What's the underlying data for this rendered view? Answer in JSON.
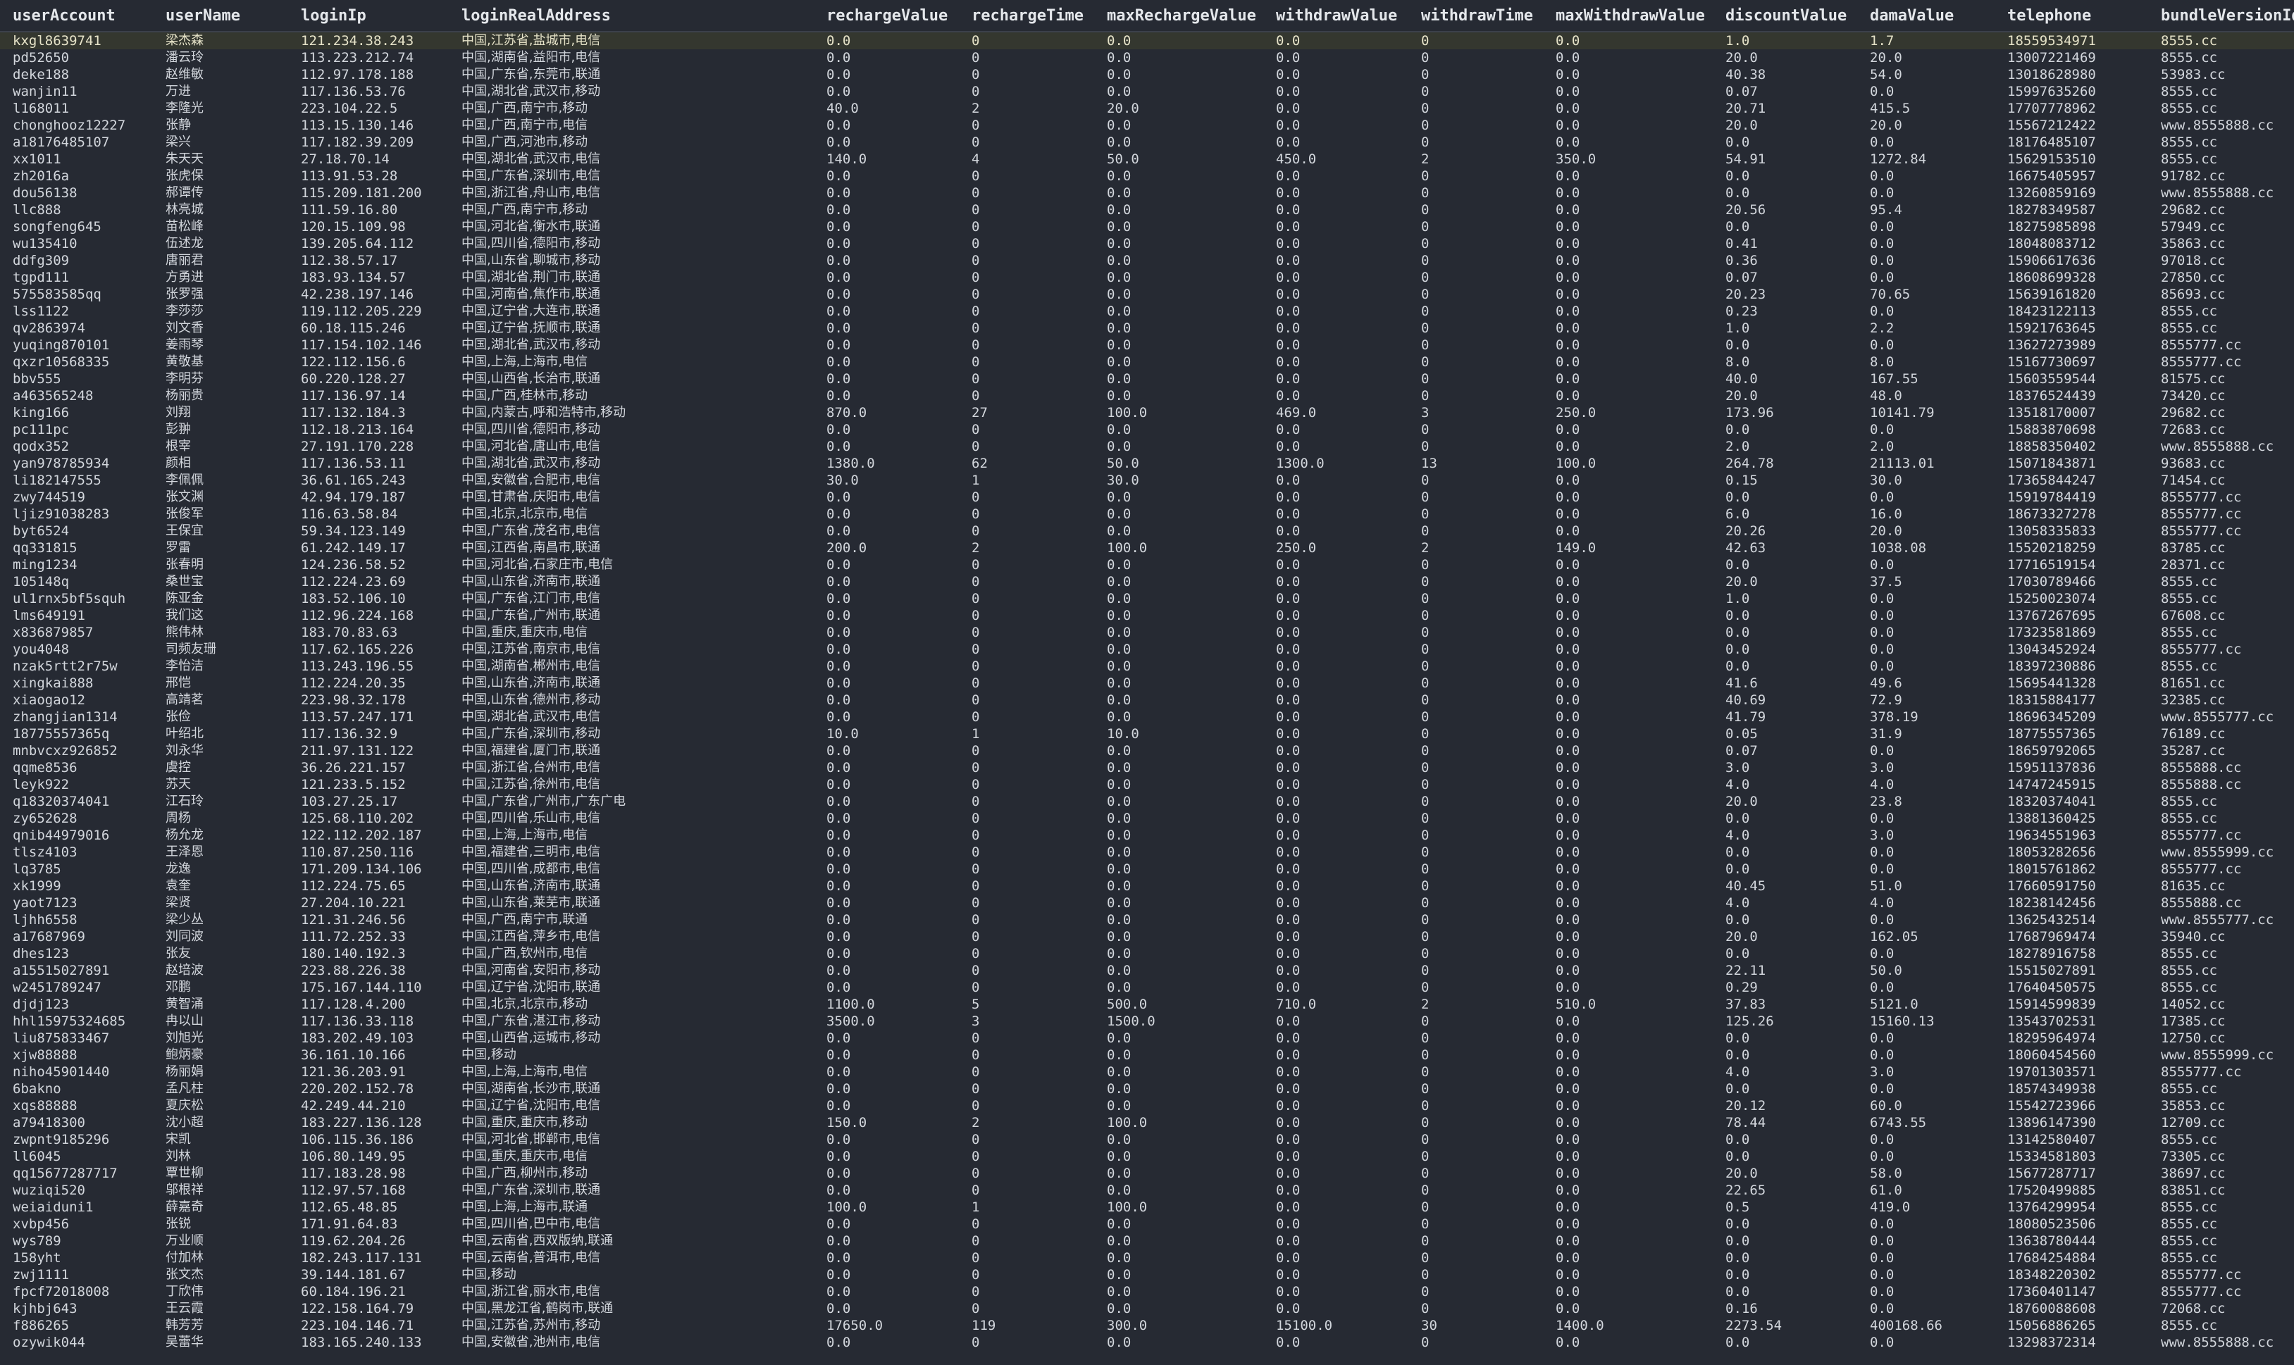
{
  "columns": [
    "userAccount",
    "userName",
    "loginIp",
    "loginRealAddress",
    "rechargeValue",
    "rechargeTime",
    "maxRechargeValue",
    "withdrawValue",
    "withdrawTime",
    "maxWithdrawValue",
    "discountValue",
    "damaValue",
    "telephone",
    "bundleVersionId"
  ],
  "selected_row": 0,
  "rows": [
    [
      "kxgl8639741",
      "梁杰森",
      "121.234.38.243",
      "中国,江苏省,盐城市,电信",
      "0.0",
      "0",
      "0.0",
      "0.0",
      "0",
      "0.0",
      "1.0",
      "1.7",
      "18559534971",
      "8555.cc"
    ],
    [
      "pd52650",
      "潘云玲",
      "113.223.212.74",
      "中国,湖南省,益阳市,电信",
      "0.0",
      "0",
      "0.0",
      "0.0",
      "0",
      "0.0",
      "20.0",
      "20.0",
      "13007221469",
      "8555.cc"
    ],
    [
      "deke188",
      "赵维敏",
      "112.97.178.188",
      "中国,广东省,东莞市,联通",
      "0.0",
      "0",
      "0.0",
      "0.0",
      "0",
      "0.0",
      "40.38",
      "54.0",
      "13018628980",
      "53983.cc"
    ],
    [
      "wanjin11",
      "万进",
      "117.136.53.76",
      "中国,湖北省,武汉市,移动",
      "0.0",
      "0",
      "0.0",
      "0.0",
      "0",
      "0.0",
      "0.07",
      "0.0",
      "15997635260",
      "8555.cc"
    ],
    [
      "l168011",
      "李隆光",
      "223.104.22.5",
      "中国,广西,南宁市,移动",
      "40.0",
      "2",
      "20.0",
      "0.0",
      "0",
      "0.0",
      "20.71",
      "415.5",
      "17707778962",
      "8555.cc"
    ],
    [
      "chonghooz12227",
      "张静",
      "113.15.130.146",
      "中国,广西,南宁市,电信",
      "0.0",
      "0",
      "0.0",
      "0.0",
      "0",
      "0.0",
      "20.0",
      "20.0",
      "15567212422",
      "www.8555888.cc"
    ],
    [
      "a18176485107",
      "梁兴",
      "117.182.39.209",
      "中国,广西,河池市,移动",
      "0.0",
      "0",
      "0.0",
      "0.0",
      "0",
      "0.0",
      "0.0",
      "0.0",
      "18176485107",
      "8555.cc"
    ],
    [
      "xx1011",
      "朱天天",
      "27.18.70.14",
      "中国,湖北省,武汉市,电信",
      "140.0",
      "4",
      "50.0",
      "450.0",
      "2",
      "350.0",
      "54.91",
      "1272.84",
      "15629153510",
      "8555.cc"
    ],
    [
      "zh2016a",
      "张虎保",
      "113.91.53.28",
      "中国,广东省,深圳市,电信",
      "0.0",
      "0",
      "0.0",
      "0.0",
      "0",
      "0.0",
      "0.0",
      "0.0",
      "16675405957",
      "91782.cc"
    ],
    [
      "dou56138",
      "郝谭传",
      "115.209.181.200",
      "中国,浙江省,舟山市,电信",
      "0.0",
      "0",
      "0.0",
      "0.0",
      "0",
      "0.0",
      "0.0",
      "0.0",
      "13260859169",
      "www.8555888.cc"
    ],
    [
      "llc888",
      "林亮城",
      "111.59.16.80",
      "中国,广西,南宁市,移动",
      "0.0",
      "0",
      "0.0",
      "0.0",
      "0",
      "0.0",
      "20.56",
      "95.4",
      "18278349587",
      "29682.cc"
    ],
    [
      "songfeng645",
      "苗松峰",
      "120.15.109.98",
      "中国,河北省,衡水市,联通",
      "0.0",
      "0",
      "0.0",
      "0.0",
      "0",
      "0.0",
      "0.0",
      "0.0",
      "18275985898",
      "57949.cc"
    ],
    [
      "wu135410",
      "伍述龙",
      "139.205.64.112",
      "中国,四川省,德阳市,移动",
      "0.0",
      "0",
      "0.0",
      "0.0",
      "0",
      "0.0",
      "0.41",
      "0.0",
      "18048083712",
      "35863.cc"
    ],
    [
      "ddfg309",
      "唐丽君",
      "112.38.57.17",
      "中国,山东省,聊城市,移动",
      "0.0",
      "0",
      "0.0",
      "0.0",
      "0",
      "0.0",
      "0.36",
      "0.0",
      "15906617636",
      "97018.cc"
    ],
    [
      "tgpd111",
      "方勇进",
      "183.93.134.57",
      "中国,湖北省,荆门市,联通",
      "0.0",
      "0",
      "0.0",
      "0.0",
      "0",
      "0.0",
      "0.07",
      "0.0",
      "18608699328",
      "27850.cc"
    ],
    [
      "575583585qq",
      "张罗强",
      "42.238.197.146",
      "中国,河南省,焦作市,联通",
      "0.0",
      "0",
      "0.0",
      "0.0",
      "0",
      "0.0",
      "20.23",
      "70.65",
      "15639161820",
      "85693.cc"
    ],
    [
      "lss1122",
      "李莎莎",
      "119.112.205.229",
      "中国,辽宁省,大连市,联通",
      "0.0",
      "0",
      "0.0",
      "0.0",
      "0",
      "0.0",
      "0.23",
      "0.0",
      "18423122113",
      "8555.cc"
    ],
    [
      "qv2863974",
      "刘文香",
      "60.18.115.246",
      "中国,辽宁省,抚顺市,联通",
      "0.0",
      "0",
      "0.0",
      "0.0",
      "0",
      "0.0",
      "1.0",
      "2.2",
      "15921763645",
      "8555.cc"
    ],
    [
      "yuqing870101",
      "姜雨琴",
      "117.154.102.146",
      "中国,湖北省,武汉市,移动",
      "0.0",
      "0",
      "0.0",
      "0.0",
      "0",
      "0.0",
      "0.0",
      "0.0",
      "13627273989",
      "8555777.cc"
    ],
    [
      "qxzr10568335",
      "黄敬基",
      "122.112.156.6",
      "中国,上海,上海市,电信",
      "0.0",
      "0",
      "0.0",
      "0.0",
      "0",
      "0.0",
      "8.0",
      "8.0",
      "15167730697",
      "8555777.cc"
    ],
    [
      "bbv555",
      "李明芬",
      "60.220.128.27",
      "中国,山西省,长治市,联通",
      "0.0",
      "0",
      "0.0",
      "0.0",
      "0",
      "0.0",
      "40.0",
      "167.55",
      "15603559544",
      "81575.cc"
    ],
    [
      "a463565248",
      "杨丽贵",
      "117.136.97.14",
      "中国,广西,桂林市,移动",
      "0.0",
      "0",
      "0.0",
      "0.0",
      "0",
      "0.0",
      "20.0",
      "48.0",
      "18376524439",
      "73420.cc"
    ],
    [
      "king166",
      "刘翔",
      "117.132.184.3",
      "中国,内蒙古,呼和浩特市,移动",
      "870.0",
      "27",
      "100.0",
      "469.0",
      "3",
      "250.0",
      "173.96",
      "10141.79",
      "13518170007",
      "29682.cc"
    ],
    [
      "pc111pc",
      "彭翀",
      "112.18.213.164",
      "中国,四川省,德阳市,移动",
      "0.0",
      "0",
      "0.0",
      "0.0",
      "0",
      "0.0",
      "0.0",
      "0.0",
      "15883870698",
      "72683.cc"
    ],
    [
      "qodx352",
      "根宰",
      "27.191.170.228",
      "中国,河北省,唐山市,电信",
      "0.0",
      "0",
      "0.0",
      "0.0",
      "0",
      "0.0",
      "2.0",
      "2.0",
      "18858350402",
      "www.8555888.cc"
    ],
    [
      "yan978785934",
      "颜相",
      "117.136.53.11",
      "中国,湖北省,武汉市,移动",
      "1380.0",
      "62",
      "50.0",
      "1300.0",
      "13",
      "100.0",
      "264.78",
      "21113.01",
      "15071843871",
      "93683.cc"
    ],
    [
      "li182147555",
      "李佩佩",
      "36.61.165.243",
      "中国,安徽省,合肥市,电信",
      "30.0",
      "1",
      "30.0",
      "0.0",
      "0",
      "0.0",
      "0.15",
      "30.0",
      "17365844247",
      "71454.cc"
    ],
    [
      "zwy744519",
      "张文渊",
      "42.94.179.187",
      "中国,甘肃省,庆阳市,电信",
      "0.0",
      "0",
      "0.0",
      "0.0",
      "0",
      "0.0",
      "0.0",
      "0.0",
      "15919784419",
      "8555777.cc"
    ],
    [
      "ljiz91038283",
      "张俊军",
      "116.63.58.84",
      "中国,北京,北京市,电信",
      "0.0",
      "0",
      "0.0",
      "0.0",
      "0",
      "0.0",
      "6.0",
      "16.0",
      "18673327278",
      "8555777.cc"
    ],
    [
      "byt6524",
      "王保宜",
      "59.34.123.149",
      "中国,广东省,茂名市,电信",
      "0.0",
      "0",
      "0.0",
      "0.0",
      "0",
      "0.0",
      "20.26",
      "20.0",
      "13058335833",
      "8555777.cc"
    ],
    [
      "qq331815",
      "罗雷",
      "61.242.149.17",
      "中国,江西省,南昌市,联通",
      "200.0",
      "2",
      "100.0",
      "250.0",
      "2",
      "149.0",
      "42.63",
      "1038.08",
      "15520218259",
      "83785.cc"
    ],
    [
      "ming1234",
      "张春明",
      "124.236.58.52",
      "中国,河北省,石家庄市,电信",
      "0.0",
      "0",
      "0.0",
      "0.0",
      "0",
      "0.0",
      "0.0",
      "0.0",
      "17716519154",
      "28371.cc"
    ],
    [
      "105148q",
      "桑世宝",
      "112.224.23.69",
      "中国,山东省,济南市,联通",
      "0.0",
      "0",
      "0.0",
      "0.0",
      "0",
      "0.0",
      "20.0",
      "37.5",
      "17030789466",
      "8555.cc"
    ],
    [
      "ul1rnx5bf5squh",
      "陈亚金",
      "183.52.106.10",
      "中国,广东省,江门市,电信",
      "0.0",
      "0",
      "0.0",
      "0.0",
      "0",
      "0.0",
      "1.0",
      "0.0",
      "15250023074",
      "8555.cc"
    ],
    [
      "lms649191",
      "我们这",
      "112.96.224.168",
      "中国,广东省,广州市,联通",
      "0.0",
      "0",
      "0.0",
      "0.0",
      "0",
      "0.0",
      "0.0",
      "0.0",
      "13767267695",
      "67608.cc"
    ],
    [
      "x836879857",
      "熊伟林",
      "183.70.83.63",
      "中国,重庆,重庆市,电信",
      "0.0",
      "0",
      "0.0",
      "0.0",
      "0",
      "0.0",
      "0.0",
      "0.0",
      "17323581869",
      "8555.cc"
    ],
    [
      "you4048",
      "司频友珊",
      "117.62.165.226",
      "中国,江苏省,南京市,电信",
      "0.0",
      "0",
      "0.0",
      "0.0",
      "0",
      "0.0",
      "0.0",
      "0.0",
      "13043452924",
      "8555777.cc"
    ],
    [
      "nzak5rtt2r75w",
      "李怡洁",
      "113.243.196.55",
      "中国,湖南省,郴州市,电信",
      "0.0",
      "0",
      "0.0",
      "0.0",
      "0",
      "0.0",
      "0.0",
      "0.0",
      "18397230886",
      "8555.cc"
    ],
    [
      "xingkai888",
      "邢恺",
      "112.224.20.35",
      "中国,山东省,济南市,联通",
      "0.0",
      "0",
      "0.0",
      "0.0",
      "0",
      "0.0",
      "41.6",
      "49.6",
      "15695441328",
      "81651.cc"
    ],
    [
      "xiaogao12",
      "高靖茗",
      "223.98.32.178",
      "中国,山东省,德州市,移动",
      "0.0",
      "0",
      "0.0",
      "0.0",
      "0",
      "0.0",
      "40.69",
      "72.9",
      "18315884177",
      "32385.cc"
    ],
    [
      "zhangjian1314",
      "张俭",
      "113.57.247.171",
      "中国,湖北省,武汉市,电信",
      "0.0",
      "0",
      "0.0",
      "0.0",
      "0",
      "0.0",
      "41.79",
      "378.19",
      "18696345209",
      "www.8555777.cc"
    ],
    [
      "18775557365q",
      "叶绍北",
      "117.136.32.9",
      "中国,广东省,深圳市,移动",
      "10.0",
      "1",
      "10.0",
      "0.0",
      "0",
      "0.0",
      "0.05",
      "31.9",
      "18775557365",
      "76189.cc"
    ],
    [
      "mnbvcxz926852",
      "刘永华",
      "211.97.131.122",
      "中国,福建省,厦门市,联通",
      "0.0",
      "0",
      "0.0",
      "0.0",
      "0",
      "0.0",
      "0.07",
      "0.0",
      "18659792065",
      "35287.cc"
    ],
    [
      "qqme8536",
      "虞控",
      "36.26.221.157",
      "中国,浙江省,台州市,电信",
      "0.0",
      "0",
      "0.0",
      "0.0",
      "0",
      "0.0",
      "3.0",
      "3.0",
      "15951137836",
      "8555888.cc"
    ],
    [
      "leyk922",
      "苏天",
      "121.233.5.152",
      "中国,江苏省,徐州市,电信",
      "0.0",
      "0",
      "0.0",
      "0.0",
      "0",
      "0.0",
      "4.0",
      "4.0",
      "14747245915",
      "8555888.cc"
    ],
    [
      "q18320374041",
      "江石玲",
      "103.27.25.17",
      "中国,广东省,广州市,广东广电",
      "0.0",
      "0",
      "0.0",
      "0.0",
      "0",
      "0.0",
      "20.0",
      "23.8",
      "18320374041",
      "8555.cc"
    ],
    [
      "zy652628",
      "周杨",
      "125.68.110.202",
      "中国,四川省,乐山市,电信",
      "0.0",
      "0",
      "0.0",
      "0.0",
      "0",
      "0.0",
      "0.0",
      "0.0",
      "13881360425",
      "8555.cc"
    ],
    [
      "qnib44979016",
      "杨允龙",
      "122.112.202.187",
      "中国,上海,上海市,电信",
      "0.0",
      "0",
      "0.0",
      "0.0",
      "0",
      "0.0",
      "4.0",
      "3.0",
      "19634551963",
      "8555777.cc"
    ],
    [
      "tlsz4103",
      "王泽恩",
      "110.87.250.116",
      "中国,福建省,三明市,电信",
      "0.0",
      "0",
      "0.0",
      "0.0",
      "0",
      "0.0",
      "0.0",
      "0.0",
      "18053282656",
      "www.8555999.cc"
    ],
    [
      "lq3785",
      "龙逸",
      "171.209.134.106",
      "中国,四川省,成都市,电信",
      "0.0",
      "0",
      "0.0",
      "0.0",
      "0",
      "0.0",
      "0.0",
      "0.0",
      "18015761862",
      "8555777.cc"
    ],
    [
      "xk1999",
      "袁奎",
      "112.224.75.65",
      "中国,山东省,济南市,联通",
      "0.0",
      "0",
      "0.0",
      "0.0",
      "0",
      "0.0",
      "40.45",
      "51.0",
      "17660591750",
      "81635.cc"
    ],
    [
      "yaot7123",
      "梁贤",
      "27.204.10.221",
      "中国,山东省,莱芜市,联通",
      "0.0",
      "0",
      "0.0",
      "0.0",
      "0",
      "0.0",
      "4.0",
      "4.0",
      "18238142456",
      "8555888.cc"
    ],
    [
      "ljhh6558",
      "梁少丛",
      "121.31.246.56",
      "中国,广西,南宁市,联通",
      "0.0",
      "0",
      "0.0",
      "0.0",
      "0",
      "0.0",
      "0.0",
      "0.0",
      "13625432514",
      "www.8555777.cc"
    ],
    [
      "a17687969",
      "刘同波",
      "111.72.252.33",
      "中国,江西省,萍乡市,电信",
      "0.0",
      "0",
      "0.0",
      "0.0",
      "0",
      "0.0",
      "20.0",
      "162.05",
      "17687969474",
      "35940.cc"
    ],
    [
      "dhes123",
      "张友",
      "180.140.192.3",
      "中国,广西,钦州市,电信",
      "0.0",
      "0",
      "0.0",
      "0.0",
      "0",
      "0.0",
      "0.0",
      "0.0",
      "18278916758",
      "8555.cc"
    ],
    [
      "a15515027891",
      "赵培波",
      "223.88.226.38",
      "中国,河南省,安阳市,移动",
      "0.0",
      "0",
      "0.0",
      "0.0",
      "0",
      "0.0",
      "22.11",
      "50.0",
      "15515027891",
      "8555.cc"
    ],
    [
      "w2451789247",
      "邓鹏",
      "175.167.144.110",
      "中国,辽宁省,沈阳市,联通",
      "0.0",
      "0",
      "0.0",
      "0.0",
      "0",
      "0.0",
      "0.29",
      "0.0",
      "17640450575",
      "8555.cc"
    ],
    [
      "djdj123",
      "黄智涌",
      "117.128.4.200",
      "中国,北京,北京市,移动",
      "1100.0",
      "5",
      "500.0",
      "710.0",
      "2",
      "510.0",
      "37.83",
      "5121.0",
      "15914599839",
      "14052.cc"
    ],
    [
      "hhl15975324685",
      "冉以山",
      "117.136.33.118",
      "中国,广东省,湛江市,移动",
      "3500.0",
      "3",
      "1500.0",
      "0.0",
      "0",
      "0.0",
      "125.26",
      "15160.13",
      "13543702531",
      "17385.cc"
    ],
    [
      "liu875833467",
      "刘旭光",
      "183.202.49.103",
      "中国,山西省,运城市,移动",
      "0.0",
      "0",
      "0.0",
      "0.0",
      "0",
      "0.0",
      "0.0",
      "0.0",
      "18295964974",
      "12750.cc"
    ],
    [
      "xjw88888",
      "鲍炳豪",
      "36.161.10.166",
      "中国,移动",
      "0.0",
      "0",
      "0.0",
      "0.0",
      "0",
      "0.0",
      "0.0",
      "0.0",
      "18060454560",
      "www.8555999.cc"
    ],
    [
      "niho45901440",
      "杨丽娟",
      "121.36.203.91",
      "中国,上海,上海市,电信",
      "0.0",
      "0",
      "0.0",
      "0.0",
      "0",
      "0.0",
      "4.0",
      "3.0",
      "19701303571",
      "8555777.cc"
    ],
    [
      "6bakno",
      "孟凡柱",
      "220.202.152.78",
      "中国,湖南省,长沙市,联通",
      "0.0",
      "0",
      "0.0",
      "0.0",
      "0",
      "0.0",
      "0.0",
      "0.0",
      "18574349938",
      "8555.cc"
    ],
    [
      "xqs88888",
      "夏庆松",
      "42.249.44.210",
      "中国,辽宁省,沈阳市,电信",
      "0.0",
      "0",
      "0.0",
      "0.0",
      "0",
      "0.0",
      "20.12",
      "60.0",
      "15542723966",
      "35853.cc"
    ],
    [
      "a79418300",
      "沈小超",
      "183.227.136.128",
      "中国,重庆,重庆市,移动",
      "150.0",
      "2",
      "100.0",
      "0.0",
      "0",
      "0.0",
      "78.44",
      "6743.55",
      "13896147390",
      "12709.cc"
    ],
    [
      "zwpnt9185296",
      "宋凯",
      "106.115.36.186",
      "中国,河北省,邯郸市,电信",
      "0.0",
      "0",
      "0.0",
      "0.0",
      "0",
      "0.0",
      "0.0",
      "0.0",
      "13142580407",
      "8555.cc"
    ],
    [
      "ll6045",
      "刘林",
      "106.80.149.95",
      "中国,重庆,重庆市,电信",
      "0.0",
      "0",
      "0.0",
      "0.0",
      "0",
      "0.0",
      "0.0",
      "0.0",
      "15334581803",
      "73305.cc"
    ],
    [
      "qq15677287717",
      "覃世柳",
      "117.183.28.98",
      "中国,广西,柳州市,移动",
      "0.0",
      "0",
      "0.0",
      "0.0",
      "0",
      "0.0",
      "20.0",
      "58.0",
      "15677287717",
      "38697.cc"
    ],
    [
      "wuziqi520",
      "邬根祥",
      "112.97.57.168",
      "中国,广东省,深圳市,联通",
      "0.0",
      "0",
      "0.0",
      "0.0",
      "0",
      "0.0",
      "22.65",
      "61.0",
      "17520499885",
      "83851.cc"
    ],
    [
      "weiaiduni1",
      "薛嘉奇",
      "112.65.48.85",
      "中国,上海,上海市,联通",
      "100.0",
      "1",
      "100.0",
      "0.0",
      "0",
      "0.0",
      "0.5",
      "419.0",
      "13764299954",
      "8555.cc"
    ],
    [
      "xvbp456",
      "张锐",
      "171.91.64.83",
      "中国,四川省,巴中市,电信",
      "0.0",
      "0",
      "0.0",
      "0.0",
      "0",
      "0.0",
      "0.0",
      "0.0",
      "18080523506",
      "8555.cc"
    ],
    [
      "wys789",
      "万业顺",
      "119.62.204.26",
      "中国,云南省,西双版纳,联通",
      "0.0",
      "0",
      "0.0",
      "0.0",
      "0",
      "0.0",
      "0.0",
      "0.0",
      "13638780444",
      "8555.cc"
    ],
    [
      "158yht",
      "付加林",
      "182.243.117.131",
      "中国,云南省,普洱市,电信",
      "0.0",
      "0",
      "0.0",
      "0.0",
      "0",
      "0.0",
      "0.0",
      "0.0",
      "17684254884",
      "8555.cc"
    ],
    [
      "zwj1111",
      "张文杰",
      "39.144.181.67",
      "中国,移动",
      "0.0",
      "0",
      "0.0",
      "0.0",
      "0",
      "0.0",
      "0.0",
      "0.0",
      "18348220302",
      "8555777.cc"
    ],
    [
      "fpcf72018008",
      "丁欣伟",
      "60.184.196.21",
      "中国,浙江省,丽水市,电信",
      "0.0",
      "0",
      "0.0",
      "0.0",
      "0",
      "0.0",
      "0.0",
      "0.0",
      "17360401147",
      "8555777.cc"
    ],
    [
      "kjhbj643",
      "王云霞",
      "122.158.164.79",
      "中国,黑龙江省,鹤岗市,联通",
      "0.0",
      "0",
      "0.0",
      "0.0",
      "0",
      "0.0",
      "0.16",
      "0.0",
      "18760088608",
      "72068.cc"
    ],
    [
      "f886265",
      "韩芳芳",
      "223.104.146.71",
      "中国,江苏省,苏州市,移动",
      "17650.0",
      "119",
      "300.0",
      "15100.0",
      "30",
      "1400.0",
      "2273.54",
      "400168.66",
      "15056886265",
      "8555.cc"
    ],
    [
      "ozywik044",
      "吴蕾华",
      "183.165.240.133",
      "中国,安徽省,池州市,电信",
      "0.0",
      "0",
      "0.0",
      "0.0",
      "0",
      "0.0",
      "0.0",
      "0.0",
      "13298372314",
      "www.8555888.cc"
    ]
  ]
}
